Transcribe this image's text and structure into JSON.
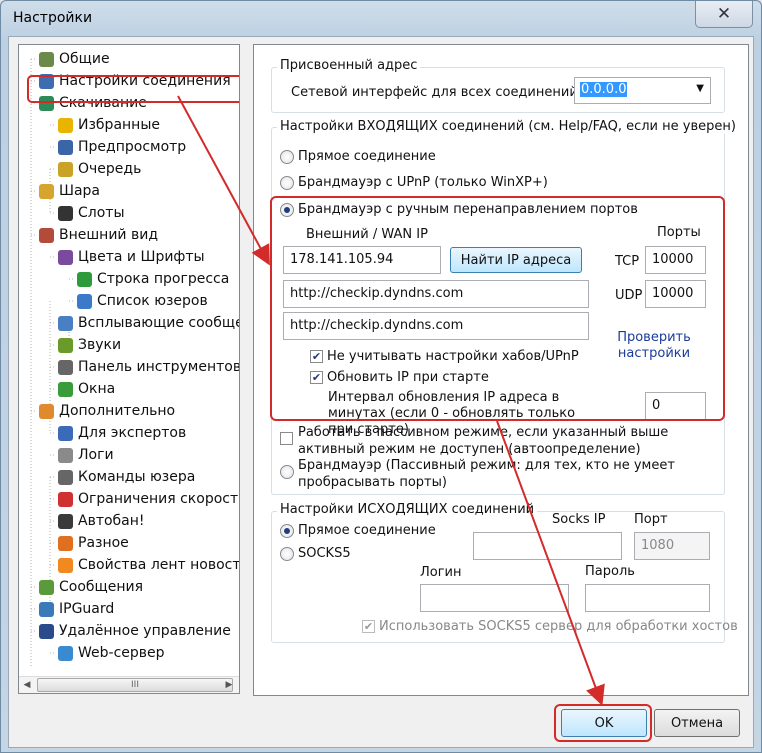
{
  "window": {
    "title": "Настройки",
    "close_glyph": "✕"
  },
  "tree": {
    "items": [
      {
        "label": "Общие",
        "icon": "general-icon",
        "color": "#6a8a4a"
      },
      {
        "label": "Настройки соединения",
        "icon": "connection-icon",
        "color": "#3b6db0"
      },
      {
        "label": "Скачивание",
        "icon": "download-icon",
        "color": "#2e8b57"
      },
      {
        "label": "Избранные",
        "icon": "star-icon",
        "color": "#e8b400"
      },
      {
        "label": "Предпросмотр",
        "icon": "preview-icon",
        "color": "#3a66a8"
      },
      {
        "label": "Очередь",
        "icon": "queue-icon",
        "color": "#c9a227"
      },
      {
        "label": "Шара",
        "icon": "share-icon",
        "color": "#d7a52e"
      },
      {
        "label": "Слоты",
        "icon": "slots-icon",
        "color": "#333333"
      },
      {
        "label": "Внешний вид",
        "icon": "appearance-icon",
        "color": "#b44a3a"
      },
      {
        "label": "Цвета и Шрифты",
        "icon": "colors-fonts-icon",
        "color": "#7a4a9c"
      },
      {
        "label": "Строка прогресса",
        "icon": "progress-flag-icon",
        "color": "#2e9b3a"
      },
      {
        "label": "Список юзеров",
        "icon": "userlist-icon",
        "color": "#3b7ac9"
      },
      {
        "label": "Всплывающие сообще",
        "icon": "popup-icon",
        "color": "#4a7fc4"
      },
      {
        "label": "Звуки",
        "icon": "sounds-icon",
        "color": "#6a9a2a"
      },
      {
        "label": "Панель инструментов",
        "icon": "toolbar-icon",
        "color": "#666666"
      },
      {
        "label": "Окна",
        "icon": "windows-icon",
        "color": "#3a9b3a"
      },
      {
        "label": "Дополнительно",
        "icon": "advanced-icon",
        "color": "#e08a2e"
      },
      {
        "label": "Для экспертов",
        "icon": "expert-icon",
        "color": "#3a6ab8"
      },
      {
        "label": "Логи",
        "icon": "logs-icon",
        "color": "#8a8a8a"
      },
      {
        "label": "Команды юзера",
        "icon": "user-commands-icon",
        "color": "#666666"
      },
      {
        "label": "Ограничения скорост",
        "icon": "speed-limit-icon",
        "color": "#d03030"
      },
      {
        "label": "Автобан!",
        "icon": "autoban-icon",
        "color": "#3a3a3a"
      },
      {
        "label": "Разное",
        "icon": "misc-icon",
        "color": "#e07020"
      },
      {
        "label": "Свойства лент новосте",
        "icon": "rss-icon",
        "color": "#f08a20"
      },
      {
        "label": "Сообщения",
        "icon": "messages-icon",
        "color": "#5a9a3a"
      },
      {
        "label": "IPGuard",
        "icon": "ipguard-icon",
        "color": "#3a7ab8"
      },
      {
        "label": "Удалённое управление",
        "icon": "remote-icon",
        "color": "#2a4a8a"
      },
      {
        "label": "Web-сервер",
        "icon": "webserver-icon",
        "color": "#3a8ad0"
      }
    ],
    "scrollbar_thumb": "III"
  },
  "assigned": {
    "group_title": "Присвоенный адрес",
    "iface_label": "Сетевой интерфейс для всех соединений",
    "iface_value": "0.0.0.0"
  },
  "incoming": {
    "group_title": "Настройки ВХОДЯЩИХ соединений (см. Help/FAQ, если не уверен)",
    "opt_direct": "Прямое соединение",
    "opt_upnp": "Брандмауэр с UPnP (только WinXP+)",
    "opt_manual": "Брандмауэр с ручным перенаправлением портов",
    "wan_label": "Внешний / WAN IP",
    "wan_value": "178.141.105.94",
    "find_ip_button": "Найти IP адреса",
    "ports_label": "Порты",
    "tcp_label": "TCP",
    "tcp_value": "10000",
    "udp_label": "UDP",
    "udp_value": "10000",
    "url1": "http://checkip.dyndns.com",
    "url2": "http://checkip.dyndns.com",
    "check_link": "Проверить настройки",
    "chk_ignore_hubs": "Не учитывать настройки хабов/UPnP",
    "chk_update_ip": "Обновить IP при старте",
    "interval_label": "Интервал обновления IP адреса в минутах (если 0 - обновлять только при старте)",
    "interval_value": "0",
    "opt_passive_active": "Работать в пассивном режиме, если указанный выше активный режим не доступен (автоопределение)",
    "opt_passive": "Брандмауэр (Пассивный режим: для тех, кто не умеет пробрасывать порты)"
  },
  "outgoing": {
    "group_title": "Настройки ИСХОДЯЩИХ соединений",
    "opt_direct": "Прямое соединение",
    "opt_socks": "SOCKS5",
    "socks_ip_label": "Socks IP",
    "port_label": "Порт",
    "port_value": "1080",
    "login_label": "Логин",
    "password_label": "Пароль",
    "chk_use_socks": "Использовать SOCKS5 сервер для обработки хостов"
  },
  "footer": {
    "ok": "OK",
    "cancel": "Отмена"
  },
  "colors": {
    "annotation": "#d32a2a",
    "link": "#1a3b9c",
    "selected_text": "#0a246a"
  }
}
